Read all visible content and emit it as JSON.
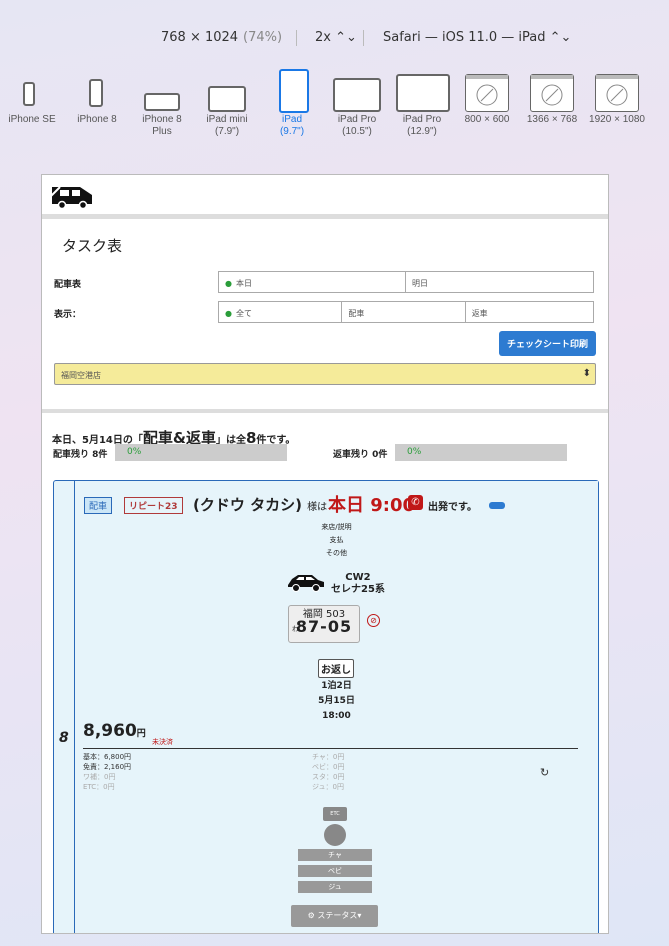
{
  "toolbar": {
    "dimensions": "768 × 1024",
    "scale_pct": "(74%)",
    "zoom": "2x ⌃⌄",
    "browser": "Safari — iOS 11.0 — iPad ⌃⌄"
  },
  "devices": [
    {
      "label": "iPhone SE",
      "sub": ""
    },
    {
      "label": "iPhone 8",
      "sub": ""
    },
    {
      "label": "iPhone 8",
      "sub": "Plus"
    },
    {
      "label": "iPad mini",
      "sub": "(7.9\")"
    },
    {
      "label": "iPad",
      "sub": "(9.7\")"
    },
    {
      "label": "iPad Pro",
      "sub": "(10.5\")"
    },
    {
      "label": "iPad Pro",
      "sub": "(12.9\")"
    },
    {
      "label": "800 × 600",
      "sub": ""
    },
    {
      "label": "1366 × 768",
      "sub": ""
    },
    {
      "label": "1920 × 1080",
      "sub": ""
    }
  ],
  "page": {
    "title": "タスク表",
    "dispatch_label": "配車表",
    "dispatch_opts": [
      "本日",
      "明日"
    ],
    "display_label": "表示：",
    "display_opts": [
      "全て",
      "配車",
      "返車"
    ],
    "print_button": "チェックシート印刷",
    "store": "福岡空港店",
    "summary_pre": "本日、5月14日の「",
    "summary_key": "配車&返車",
    "summary_mid": "」は全",
    "summary_count": "8",
    "summary_post": "件です。",
    "dispatch_remaining": "配車残り 8件",
    "dispatch_pct": "0%",
    "return_remaining": "返車残り 0件",
    "return_pct": "0%"
  },
  "card": {
    "badge_dispatch": "配車",
    "badge_repeat": "リピート23",
    "customer": "(クドウ タカシ)",
    "sama": "様は",
    "when": "本日 9:00",
    "phone_icon": "✆",
    "departure": "出発です。",
    "lines": [
      "来店/説明",
      "支払",
      "その他"
    ],
    "class": "CW2",
    "model": "セレナ25系",
    "plate_area": "福岡 503",
    "plate_kana": "わ",
    "plate_num": "87-05",
    "no_smoking": "⊘",
    "return_button": "お返し",
    "nights": "1泊2日",
    "return_date": "5月15日",
    "return_time": "18:00",
    "row_num": "8",
    "price": "8,960",
    "yen": "円",
    "unpaid": "未決済",
    "fees_left": [
      "基本：6,800円",
      "免責：2,160円",
      "ワ補：0円",
      "ETC：0円"
    ],
    "fees_right": [
      "チャ：0円",
      "ベビ：0円",
      "スタ：0円",
      "ジュ：0円"
    ],
    "refresh_icon": "↻",
    "etc_label": "ETC",
    "options": [
      "チャ",
      "ベビ",
      "ジュ"
    ],
    "status_button": "⚙ ステータス▾"
  }
}
